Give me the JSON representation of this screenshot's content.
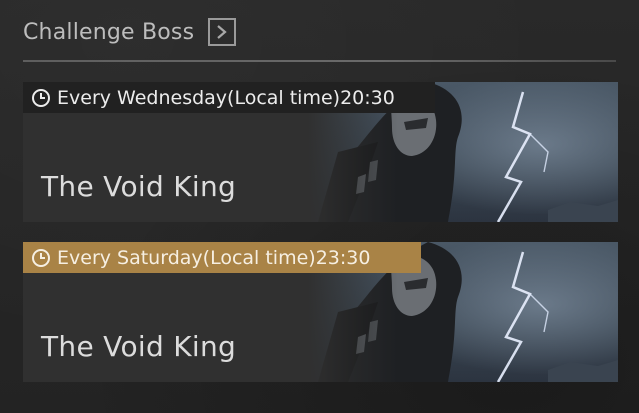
{
  "header": {
    "title": "Challenge Boss",
    "arrow_icon": "chevron-right-icon"
  },
  "cards": [
    {
      "schedule": "Every Wednesday(Local time)20:30",
      "boss_name": "The Void King",
      "highlighted": false,
      "tag_color": "#212121"
    },
    {
      "schedule": "Every Saturday(Local time)23:30",
      "boss_name": "The Void King",
      "highlighted": true,
      "tag_color": "#a98346"
    }
  ]
}
